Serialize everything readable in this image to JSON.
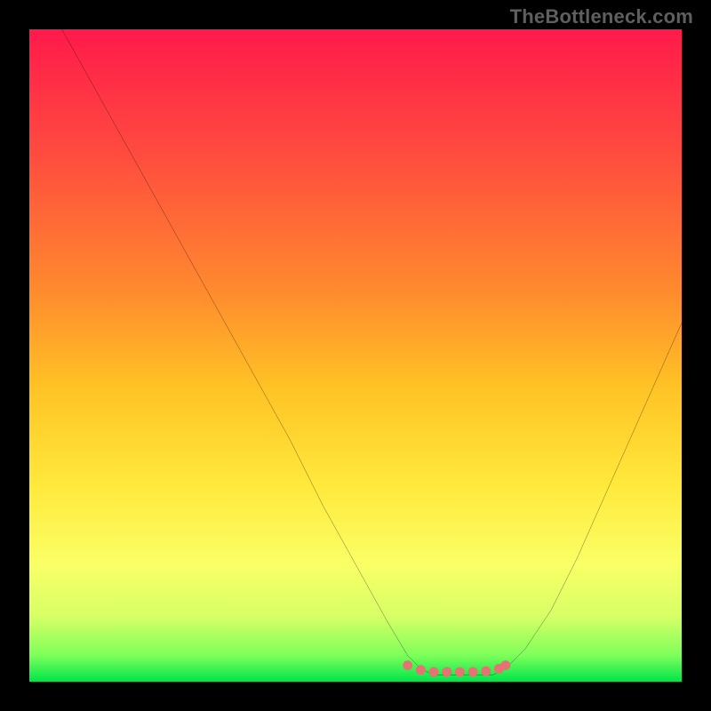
{
  "watermark": "TheBottleneck.com",
  "chart_data": {
    "type": "line",
    "title": "",
    "xlabel": "",
    "ylabel": "",
    "xlim": [
      0,
      100
    ],
    "ylim": [
      0,
      100
    ],
    "grid": false,
    "legend": false,
    "background_gradient": {
      "stops": [
        {
          "pos": 0.0,
          "color": "#ff1a4b"
        },
        {
          "pos": 0.2,
          "color": "#ff4e3e"
        },
        {
          "pos": 0.4,
          "color": "#ff8a2e"
        },
        {
          "pos": 0.55,
          "color": "#ffc325"
        },
        {
          "pos": 0.7,
          "color": "#ffe93c"
        },
        {
          "pos": 0.82,
          "color": "#faff66"
        },
        {
          "pos": 0.9,
          "color": "#d7ff66"
        },
        {
          "pos": 0.96,
          "color": "#7dff5a"
        },
        {
          "pos": 1.0,
          "color": "#00e54a"
        }
      ]
    },
    "series": [
      {
        "name": "left-arm",
        "color": "#000000",
        "width": 2,
        "x": [
          5,
          10,
          15,
          20,
          25,
          30,
          35,
          40,
          45,
          50,
          55,
          58,
          60
        ],
        "y": [
          100,
          91,
          82,
          73,
          64,
          55,
          46,
          37,
          27,
          18,
          9,
          4,
          2
        ]
      },
      {
        "name": "valley",
        "color": "#000000",
        "width": 2,
        "x": [
          60,
          62,
          65,
          68,
          71,
          73
        ],
        "y": [
          2,
          1,
          1,
          1,
          1,
          2
        ]
      },
      {
        "name": "right-arm",
        "color": "#000000",
        "width": 2,
        "x": [
          73,
          76,
          80,
          84,
          88,
          92,
          96,
          100
        ],
        "y": [
          2,
          5,
          11,
          19,
          28,
          37,
          46,
          55
        ]
      },
      {
        "name": "marker-row",
        "type": "scatter",
        "color": "#e57373",
        "marker_size": 11,
        "x": [
          58,
          60,
          62,
          64,
          66,
          68,
          70,
          72,
          73
        ],
        "y": [
          2.5,
          1.8,
          1.5,
          1.5,
          1.5,
          1.5,
          1.6,
          2.0,
          2.5
        ]
      }
    ]
  }
}
